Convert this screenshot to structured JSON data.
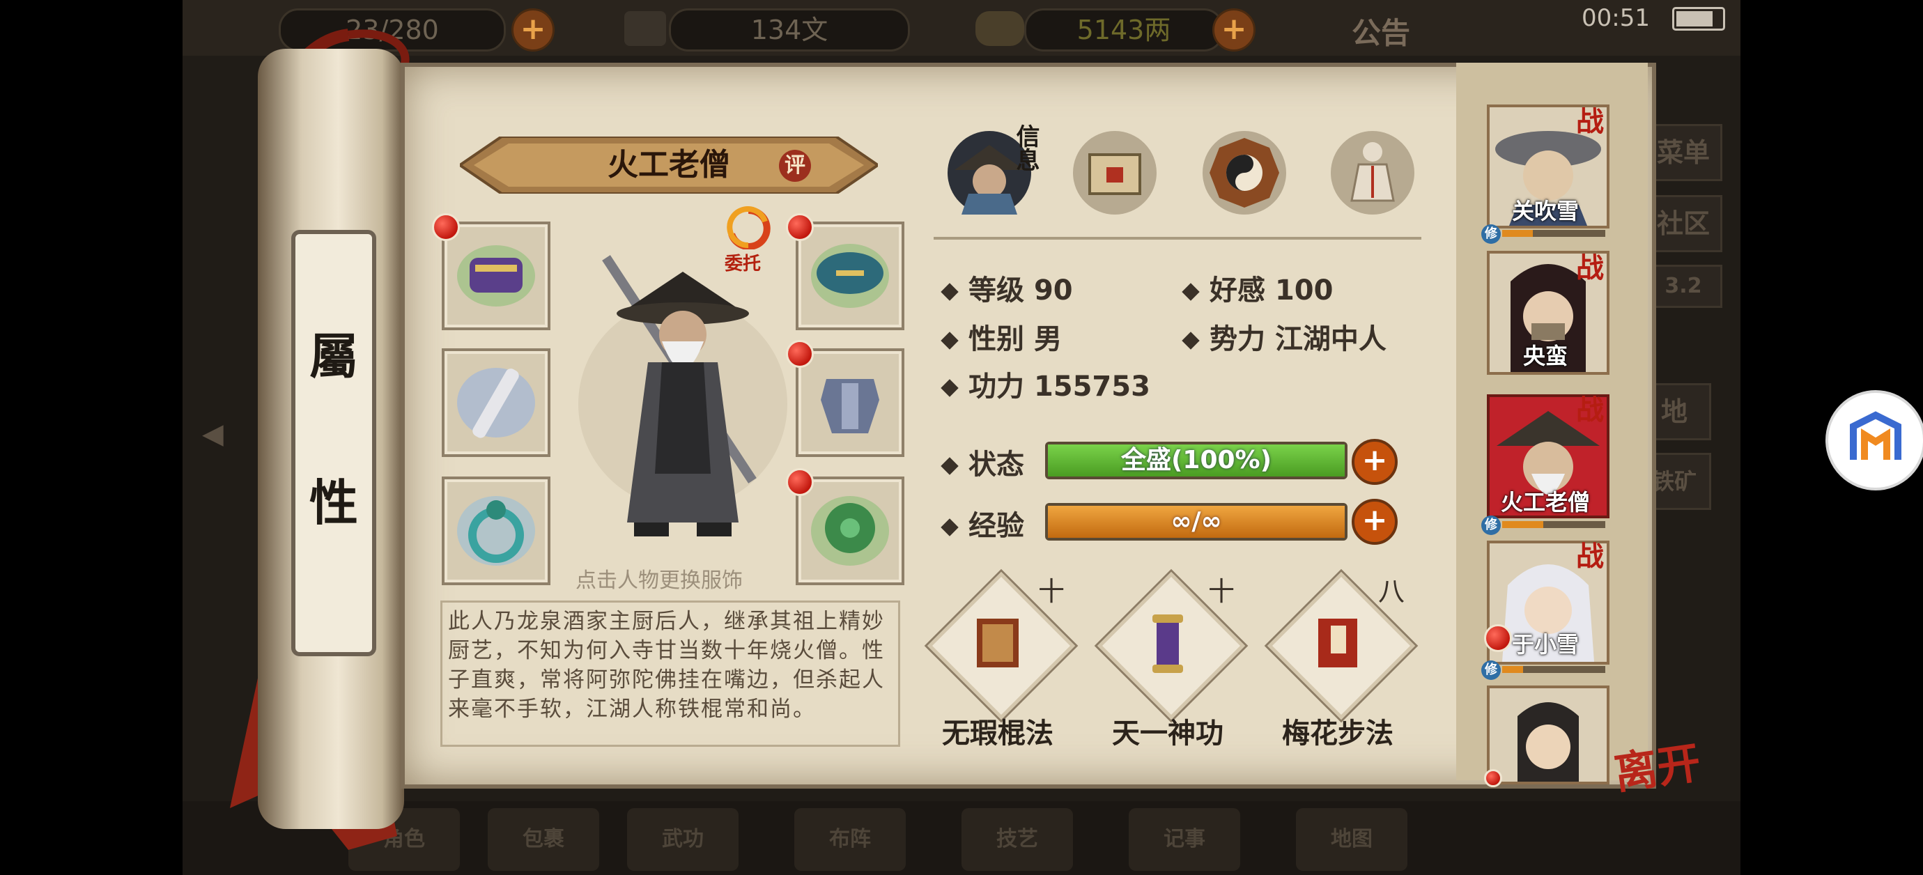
{
  "status_bar": {
    "time": "00:51"
  },
  "top_bar": {
    "resource1": "23/280",
    "resource2": "134文",
    "resource3": "5143两",
    "notice": "公告"
  },
  "right_menu": {
    "menu": "菜单",
    "community": "社区",
    "badge": "3.2",
    "item_a": "地",
    "item_b": "铁矿"
  },
  "bottom_nav": [
    {
      "label": "角色"
    },
    {
      "label": "包裹"
    },
    {
      "label": "武功"
    },
    {
      "label": "布阵"
    },
    {
      "label": "技艺"
    },
    {
      "label": "记事"
    },
    {
      "label": "地图"
    }
  ],
  "scroll": {
    "title_top": "屬",
    "title_bottom": "性"
  },
  "hero": {
    "name": "火工老僧",
    "rate": "评",
    "entrust": "委托",
    "outfit_hint": "点击人物更换服饰",
    "bio": "此人乃龙泉酒家主厨后人，继承其祖上精妙厨艺，不知为何入寺甘当数十年烧火僧。性子直爽，常将阿弥陀佛挂在嘴边，但杀起人来毫不手软，江湖人称铁棍常和尚。"
  },
  "tabs": {
    "info": "信息"
  },
  "stats": {
    "level_label": "等级",
    "level": "90",
    "favor_label": "好感",
    "favor": "100",
    "gender_label": "性别",
    "gender": "男",
    "faction_label": "势力",
    "faction": "江湖中人",
    "power_label": "功力",
    "power": "155753",
    "state_label": "状态",
    "state_value": "全盛(100%)",
    "state_fill": 1.0,
    "exp_label": "经验",
    "exp_value": "∞/∞",
    "exp_fill": 1.0
  },
  "skills": [
    {
      "name": "无瑕棍法",
      "level": "十"
    },
    {
      "name": "天一神功",
      "level": "十"
    },
    {
      "name": "梅花步法",
      "level": "八"
    }
  ],
  "roster": [
    {
      "name": "关吹雪",
      "battle": "战",
      "cultivate": "修"
    },
    {
      "name": "央蛮",
      "battle": "战",
      "cultivate": ""
    },
    {
      "name": "火工老僧",
      "battle": "战",
      "cultivate": "修"
    },
    {
      "name": "于小雪",
      "battle": "战",
      "cultivate": "修"
    },
    {
      "name": "",
      "battle": "",
      "cultivate": ""
    }
  ],
  "leave": "离开",
  "colors": {
    "state_bar": "#5fb52c",
    "exp_bar": "#e08b1c",
    "accent_red": "#c2180e"
  }
}
